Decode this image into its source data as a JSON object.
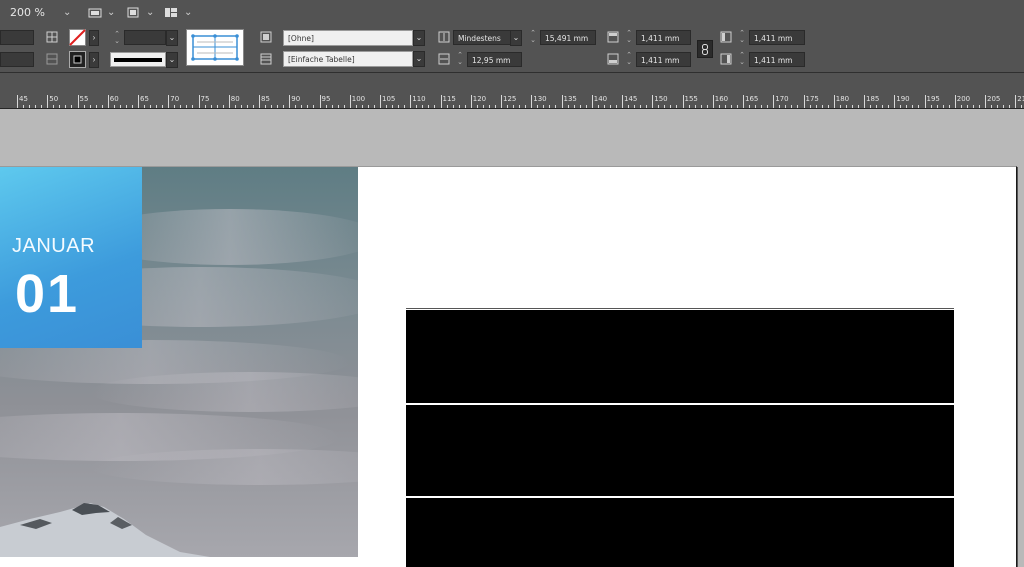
{
  "app_bar": {
    "zoom": "200 %"
  },
  "control": {
    "style_none": "[Ohne]",
    "table_style": "[Einfache Tabelle]",
    "row_height_mode": "Mindestens",
    "row_height": "15,491 mm",
    "column_width": "12,95 mm",
    "inset_top": "1,411 mm",
    "inset_bottom": "1,411 mm",
    "inset_left": "1,411 mm",
    "inset_right": "1,411 mm"
  },
  "ruler": {
    "labels": [
      "45",
      "50",
      "55",
      "60",
      "65",
      "70",
      "75",
      "80",
      "85",
      "90",
      "95",
      "100",
      "105",
      "110",
      "115",
      "120",
      "125",
      "130",
      "135",
      "140",
      "145",
      "150",
      "155",
      "160",
      "165",
      "170",
      "175",
      "180",
      "185",
      "190",
      "195",
      "200",
      "205",
      "21"
    ]
  },
  "calendar": {
    "month": "JANUAR",
    "day": "01"
  },
  "colors": {
    "accent_top": "#5ec9ee",
    "accent_bottom": "#3a8fd6",
    "ui_bg": "#535353",
    "table_fill": "#000000"
  }
}
